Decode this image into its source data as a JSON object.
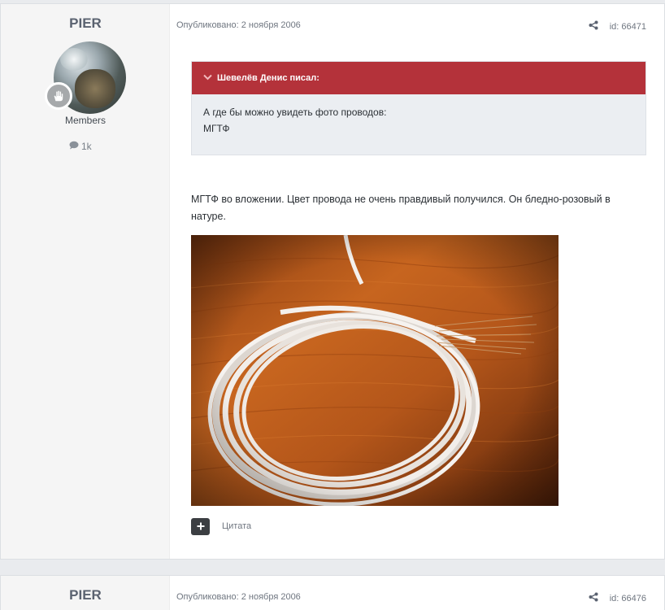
{
  "posts": [
    {
      "author": "PIER",
      "group": "Members",
      "post_count": "1k",
      "published": "Опубликовано: 2 ноября 2006",
      "post_id": "id: 66471",
      "quote": {
        "author_line": "Шевелёв Денис писал:",
        "line1": "А где бы можно увидеть фото проводов:",
        "line2": "МГТФ"
      },
      "text": "МГТФ во вложении. Цвет провода не очень правдивый получился. Он бледно-розовый в натуре.",
      "attachment": "photo of coiled white MGTF wire on wooden surface",
      "quote_button_label": "Цитата"
    },
    {
      "author": "PIER",
      "published": "Опубликовано: 2 ноября 2006",
      "post_id": "id: 66476"
    }
  ],
  "colors": {
    "quote_header": "#b4323a",
    "sidebar_bg": "#f5f5f5",
    "page_bg": "#e9ebee"
  },
  "icons": {
    "share": "share-icon",
    "comment": "comment-icon",
    "rank": "hand-rank-icon",
    "quote_chevron": "chevron-down-icon",
    "quote_plus": "plus-icon"
  }
}
